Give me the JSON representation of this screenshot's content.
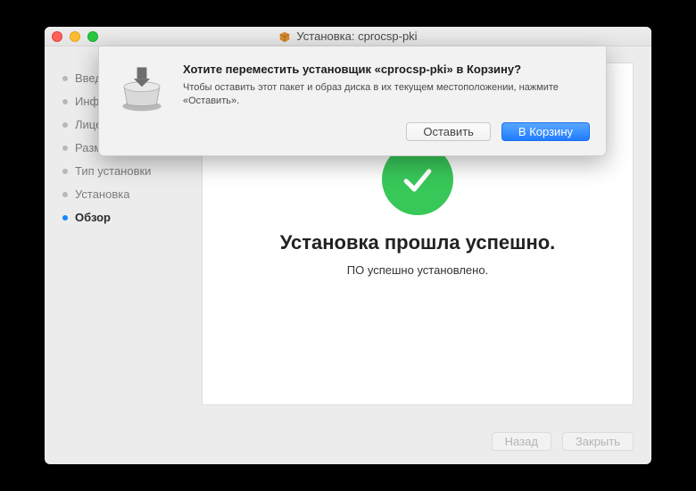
{
  "window": {
    "title": "Установка: cprocsp-pki"
  },
  "sidebar": {
    "items": [
      {
        "label": "Введение",
        "active": false
      },
      {
        "label": "Информация",
        "active": false
      },
      {
        "label": "Лицензия",
        "active": false
      },
      {
        "label": "Размещение",
        "active": false
      },
      {
        "label": "Тип установки",
        "active": false
      },
      {
        "label": "Установка",
        "active": false
      },
      {
        "label": "Обзор",
        "active": true
      }
    ]
  },
  "main": {
    "heading": "Установка прошла успешно.",
    "message": "ПО успешно установлено."
  },
  "footer": {
    "back_label": "Назад",
    "close_label": "Закрыть"
  },
  "dialog": {
    "title": "Хотите переместить установщик «cprocsp-pki» в Корзину?",
    "message": "Чтобы оставить этот пакет и образ диска в их текущем местоположении, нажмите «Оставить».",
    "keep_label": "Оставить",
    "trash_label": "В Корзину"
  }
}
